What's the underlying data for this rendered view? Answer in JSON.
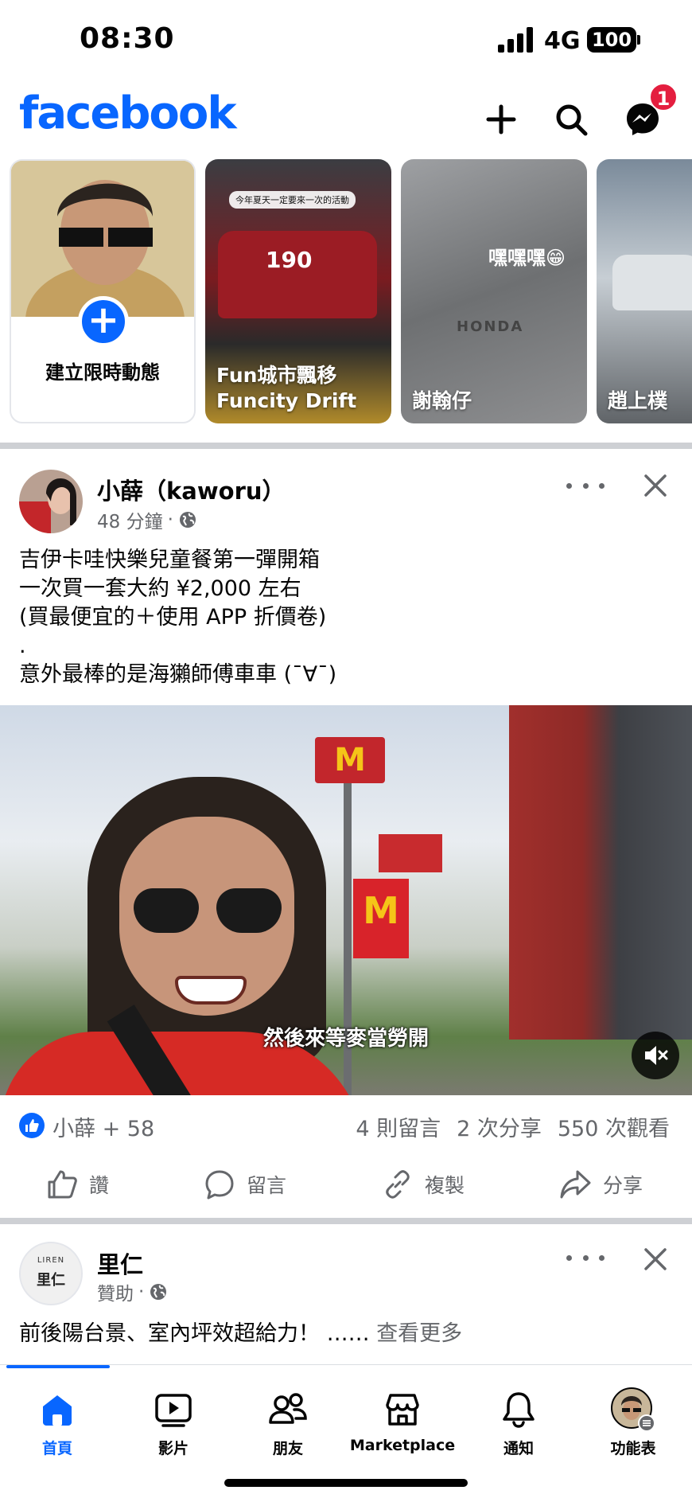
{
  "status_bar": {
    "time": "08:30",
    "network": "4G",
    "battery": "100"
  },
  "header": {
    "logo": "facebook",
    "notification_count": "1",
    "icons": [
      "plus-icon",
      "search-icon",
      "messenger-icon"
    ]
  },
  "stories": [
    {
      "label": "建立限時動態",
      "icon": "plus-icon"
    },
    {
      "label_line1": "Fun城市飄移",
      "label_line2": "Funcity Drift",
      "chip": "今年夏天一定要來一次的活動",
      "car_number": "190"
    },
    {
      "label": "謝翰仔",
      "sticker": "嘿嘿嘿😁",
      "brand": "HONDA"
    },
    {
      "label": "趙上樸"
    }
  ],
  "post1": {
    "author": "小薛（kaworu）",
    "time": "48 分鐘",
    "privacy_icon": "globe-icon",
    "text_lines": [
      "吉伊卡哇快樂兒童餐第一彈開箱",
      "一次買一套大約 ¥2,000 左右",
      "(買最便宜的＋使用 APP 折價卷)",
      ".",
      "意外最棒的是海獺師傅車車 (¯∀¯)"
    ],
    "video_subtitle": "然後來等麥當勞開",
    "reactions_text": "小薛 + 58",
    "comments": "4 則留言",
    "shares": "2 次分享",
    "views": "550 次觀看",
    "actions": {
      "like": "讚",
      "comment": "留言",
      "copy": "複製",
      "share": "分享"
    }
  },
  "post2": {
    "author": "里仁",
    "avatar_text": "里仁",
    "avatar_sub": "LIREN",
    "meta": "贊助",
    "text": "前後陽台景、室內坪效超給力！ ……",
    "see_more": "查看更多"
  },
  "tabs": [
    {
      "label": "首頁",
      "icon": "home-icon",
      "active": true
    },
    {
      "label": "影片",
      "icon": "video-icon"
    },
    {
      "label": "朋友",
      "icon": "friends-icon"
    },
    {
      "label": "Marketplace",
      "icon": "marketplace-icon"
    },
    {
      "label": "通知",
      "icon": "bell-icon"
    },
    {
      "label": "功能表",
      "icon": "profile-menu-icon"
    }
  ],
  "colors": {
    "brand": "#0866ff",
    "badge": "#e41e3f",
    "secondary_text": "#65676b"
  }
}
